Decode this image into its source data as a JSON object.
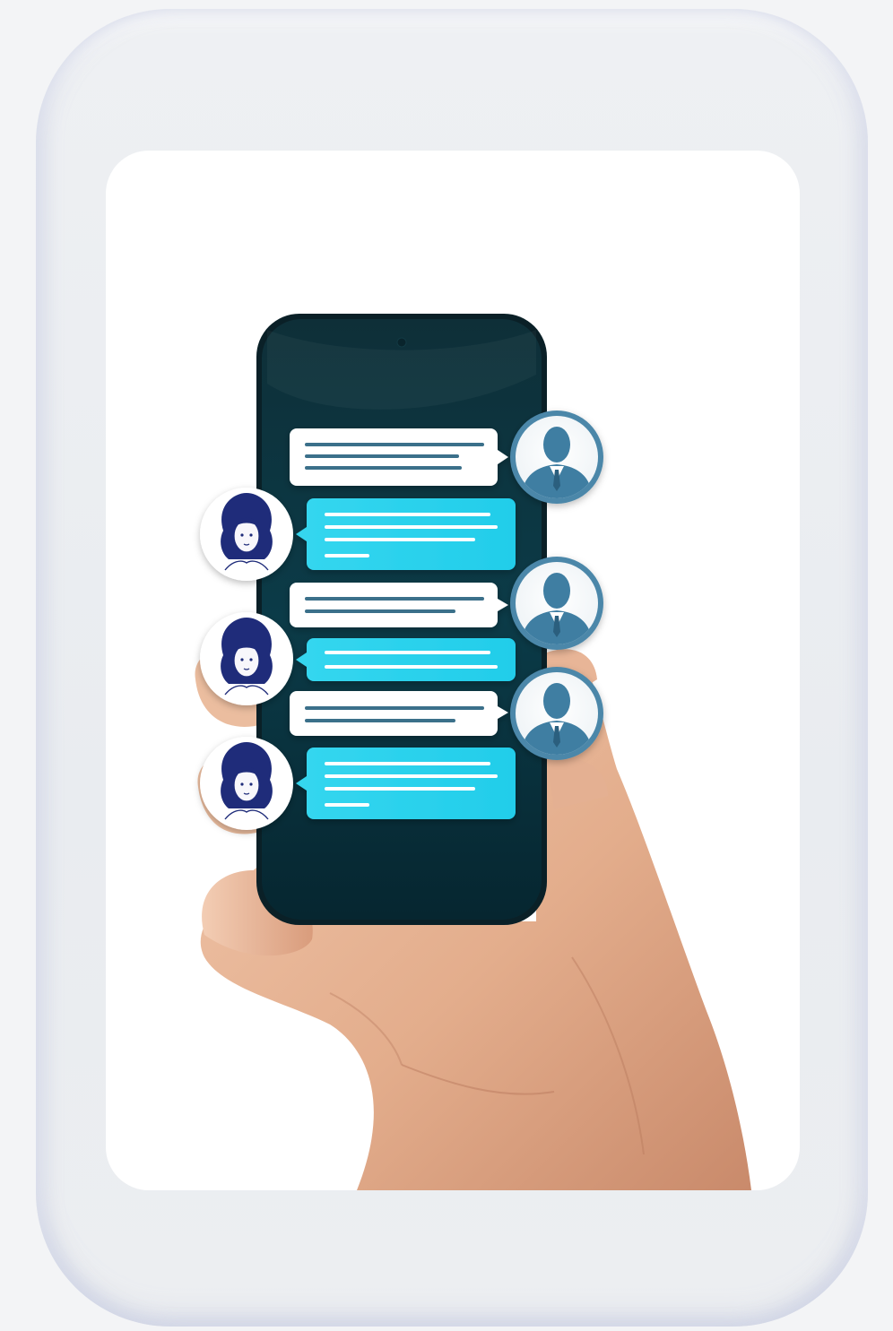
{
  "image": {
    "subject": "hand-holding-smartphone-with-chat",
    "accent_colors": {
      "frame": "#eceef1",
      "card": "#ffffff",
      "phone_screen": "#0a3340",
      "incoming_bubble": "#ffffff",
      "outgoing_bubble": "#2ed3ee",
      "avatar_ring": "#4a87a8",
      "male_avatar": "#3f7ea2",
      "female_avatar": "#1f2c7a",
      "skin": "#e9b99a"
    },
    "icons": [
      "male-avatar-icon",
      "female-avatar-icon"
    ],
    "chat": {
      "messages": [
        {
          "side": "left-bubble",
          "sender": "male",
          "bubble": "white",
          "lines": 3
        },
        {
          "side": "right-bubble",
          "sender": "female",
          "bubble": "cyan",
          "lines": 4
        },
        {
          "side": "left-bubble",
          "sender": "male",
          "bubble": "white",
          "lines": 2
        },
        {
          "side": "right-bubble",
          "sender": "female",
          "bubble": "cyan",
          "lines": 2
        },
        {
          "side": "left-bubble",
          "sender": "male",
          "bubble": "white",
          "lines": 2
        },
        {
          "side": "right-bubble",
          "sender": "female",
          "bubble": "cyan",
          "lines": 4
        }
      ]
    }
  }
}
